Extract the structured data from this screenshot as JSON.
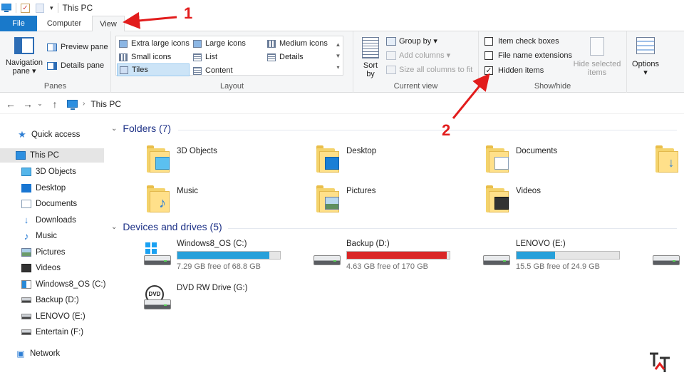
{
  "window": {
    "title": "This PC"
  },
  "tabs": {
    "file": "File",
    "computer": "Computer",
    "view": "View"
  },
  "ribbon": {
    "panes": {
      "label": "Panes",
      "navigation_pane": "Navigation pane",
      "preview_pane": "Preview pane",
      "details_pane": "Details pane"
    },
    "layout": {
      "label": "Layout",
      "items": [
        "Extra large icons",
        "Large icons",
        "Medium icons",
        "Small icons",
        "List",
        "Details",
        "Tiles",
        "Content"
      ],
      "selected": "Tiles"
    },
    "current_view": {
      "label": "Current view",
      "sort_by": "Sort by",
      "group_by": "Group by",
      "add_columns": "Add columns",
      "size_all_columns": "Size all columns to fit"
    },
    "show_hide": {
      "label": "Show/hide",
      "item_check_boxes": "Item check boxes",
      "file_name_extensions": "File name extensions",
      "hidden_items": "Hidden items",
      "hide_selected_items": "Hide selected items",
      "checked": {
        "item_check_boxes": false,
        "file_name_extensions": false,
        "hidden_items": true
      }
    },
    "options": {
      "label": "Options"
    }
  },
  "address": {
    "path": "This PC"
  },
  "sidebar": {
    "quick_access": "Quick access",
    "this_pc": "This PC",
    "items": [
      "3D Objects",
      "Desktop",
      "Documents",
      "Downloads",
      "Music",
      "Pictures",
      "Videos",
      "Windows8_OS (C:)",
      "Backup (D:)",
      "LENOVO (E:)",
      "Entertain (F:)"
    ],
    "network": "Network"
  },
  "main": {
    "folders_header": "Folders (7)",
    "folders": [
      "3D Objects",
      "Desktop",
      "Documents",
      "Music",
      "Pictures",
      "Videos"
    ],
    "devices_header": "Devices and drives (5)",
    "drives": [
      {
        "name": "Windows8_OS (C:)",
        "free": "7.29 GB free of 68.8 GB",
        "used_fraction": 0.894,
        "color": "#26a0da"
      },
      {
        "name": "Backup (D:)",
        "free": "4.63 GB free of 170 GB",
        "used_fraction": 0.973,
        "color": "#da2626"
      },
      {
        "name": "LENOVO (E:)",
        "free": "15.5 GB free of 24.9 GB",
        "used_fraction": 0.378,
        "color": "#26a0da"
      },
      {
        "name": "DVD RW Drive (G:)",
        "free": "",
        "used_fraction": null,
        "color": ""
      }
    ]
  },
  "annotations": {
    "step1": "1",
    "step2": "2"
  },
  "colors": {
    "accent": "#1979ca",
    "annotation": "#e21c1c",
    "header_text": "#1e3287"
  }
}
